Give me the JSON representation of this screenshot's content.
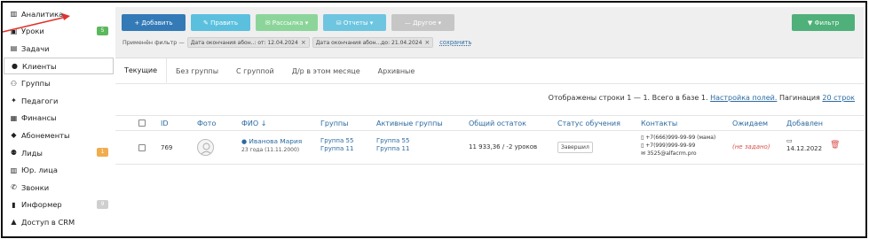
{
  "sidebar": {
    "items": [
      {
        "icon": "dashboard-icon",
        "glyph": "▥",
        "label": "Аналитика",
        "badge": "",
        "active": false
      },
      {
        "icon": "calendar-icon",
        "glyph": "▣",
        "label": "Уроки",
        "badge": "5",
        "badge_color": "#5cb85c",
        "active": false
      },
      {
        "icon": "tasks-icon",
        "glyph": "▤",
        "label": "Задачи",
        "badge": "",
        "active": false
      },
      {
        "icon": "user-icon",
        "glyph": "●",
        "label": "Клиенты",
        "badge": "",
        "active": true
      },
      {
        "icon": "group-icon",
        "glyph": "⚇",
        "label": "Группы",
        "badge": "",
        "active": false
      },
      {
        "icon": "teacher-icon",
        "glyph": "✦",
        "label": "Педагоги",
        "badge": "",
        "active": false
      },
      {
        "icon": "finance-icon",
        "glyph": "▦",
        "label": "Финансы",
        "badge": "",
        "active": false
      },
      {
        "icon": "tag-icon",
        "glyph": "◆",
        "label": "Абонементы",
        "badge": "",
        "active": false
      },
      {
        "icon": "leads-icon",
        "glyph": "⚉",
        "label": "Лиды",
        "badge": "1",
        "badge_color": "#f0ad4e",
        "active": false
      },
      {
        "icon": "building-icon",
        "glyph": "▥",
        "label": "Юр. лица",
        "badge": "",
        "active": false
      },
      {
        "icon": "phone-icon",
        "glyph": "✆",
        "label": "Звонки",
        "badge": "",
        "active": false
      },
      {
        "icon": "book-icon",
        "glyph": "▮",
        "label": "Информер",
        "badge": "9",
        "badge_color": "#cfcfcf",
        "active": false
      },
      {
        "icon": "lock-icon",
        "glyph": "▲",
        "label": "Доступ в CRM",
        "badge": "",
        "active": false
      }
    ]
  },
  "toolbar": {
    "add": "+ Добавить",
    "edit": "✎ Править",
    "mailing": "✉ Рассылка ▾",
    "reports": "⛁ Отчеты ▾",
    "other": "— Другое ▾",
    "filter": "▼ Фильтр"
  },
  "colors": {
    "add": "#337ab7",
    "edit": "#5bc0de",
    "mailing": "#8cd59a",
    "reports": "#6ec5e0",
    "other": "#c6c6c6",
    "filter": "#4fb07a"
  },
  "filters": {
    "applied_label": "Применён фильтр —",
    "chips": [
      "Дата окончания абон..: от: 12.04.2024",
      "Дата окончания абон...до: 21.04.2024"
    ],
    "save_label": "сохранить"
  },
  "tabs": [
    "Текущие",
    "Без группы",
    "С группой",
    "Д/р в этом месяце",
    "Архивные"
  ],
  "summary": {
    "text": "Отображены строки 1 — 1. Всего в базе 1.",
    "columns_link": "Настройка полей.",
    "pagination_label": "Пагинация",
    "pagination_value": "20 строк"
  },
  "table": {
    "headers": [
      "ID",
      "Фото",
      "ФИО ↓",
      "Группы",
      "Активные группы",
      "Общий остаток",
      "Статус обучения",
      "Контакты",
      "Ожидаем",
      "Добавлен"
    ],
    "rows": [
      {
        "id": "769",
        "name": "Иванова Мария",
        "age": "23 года (11.11.2000)",
        "groups": [
          "Группа 55",
          "Группа 11"
        ],
        "active_groups": [
          "Группа 55",
          "Группа 11"
        ],
        "balance": "11 933,36 / -2 уроков",
        "status": "Завершил",
        "contacts": [
          "+7(666)999-99-99 (мама)",
          "+7(999)999-99-99",
          "3525@alfacrm.pro"
        ],
        "expected": "(не задано)",
        "added": "14.12.2022"
      }
    ]
  }
}
